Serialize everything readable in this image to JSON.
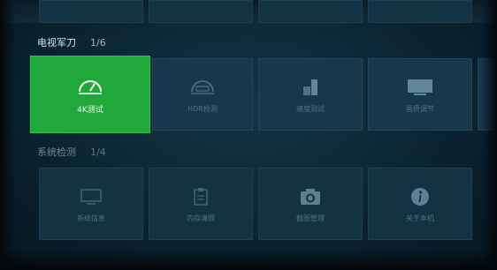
{
  "section1": {
    "title": "电视军刀",
    "count": "1/6",
    "tiles": [
      {
        "label": "4K测试",
        "icon": "speedometer-icon"
      },
      {
        "label": "HDR检测",
        "icon": "hdr-icon"
      },
      {
        "label": "速度测试",
        "icon": "bar-chart-icon"
      },
      {
        "label": "画质调节",
        "icon": "monitor-icon"
      }
    ]
  },
  "section2": {
    "title": "系统检测",
    "count": "1/4",
    "tiles": [
      {
        "label": "系统信息",
        "icon": "tv-icon"
      },
      {
        "label": "内存清理",
        "icon": "clipboard-icon"
      },
      {
        "label": "截图管理",
        "icon": "camera-icon"
      },
      {
        "label": "关于本机",
        "icon": "info-icon"
      }
    ]
  },
  "colors": {
    "selected": "#20a93a",
    "tile": "#17384b",
    "background": "#0b2432"
  }
}
